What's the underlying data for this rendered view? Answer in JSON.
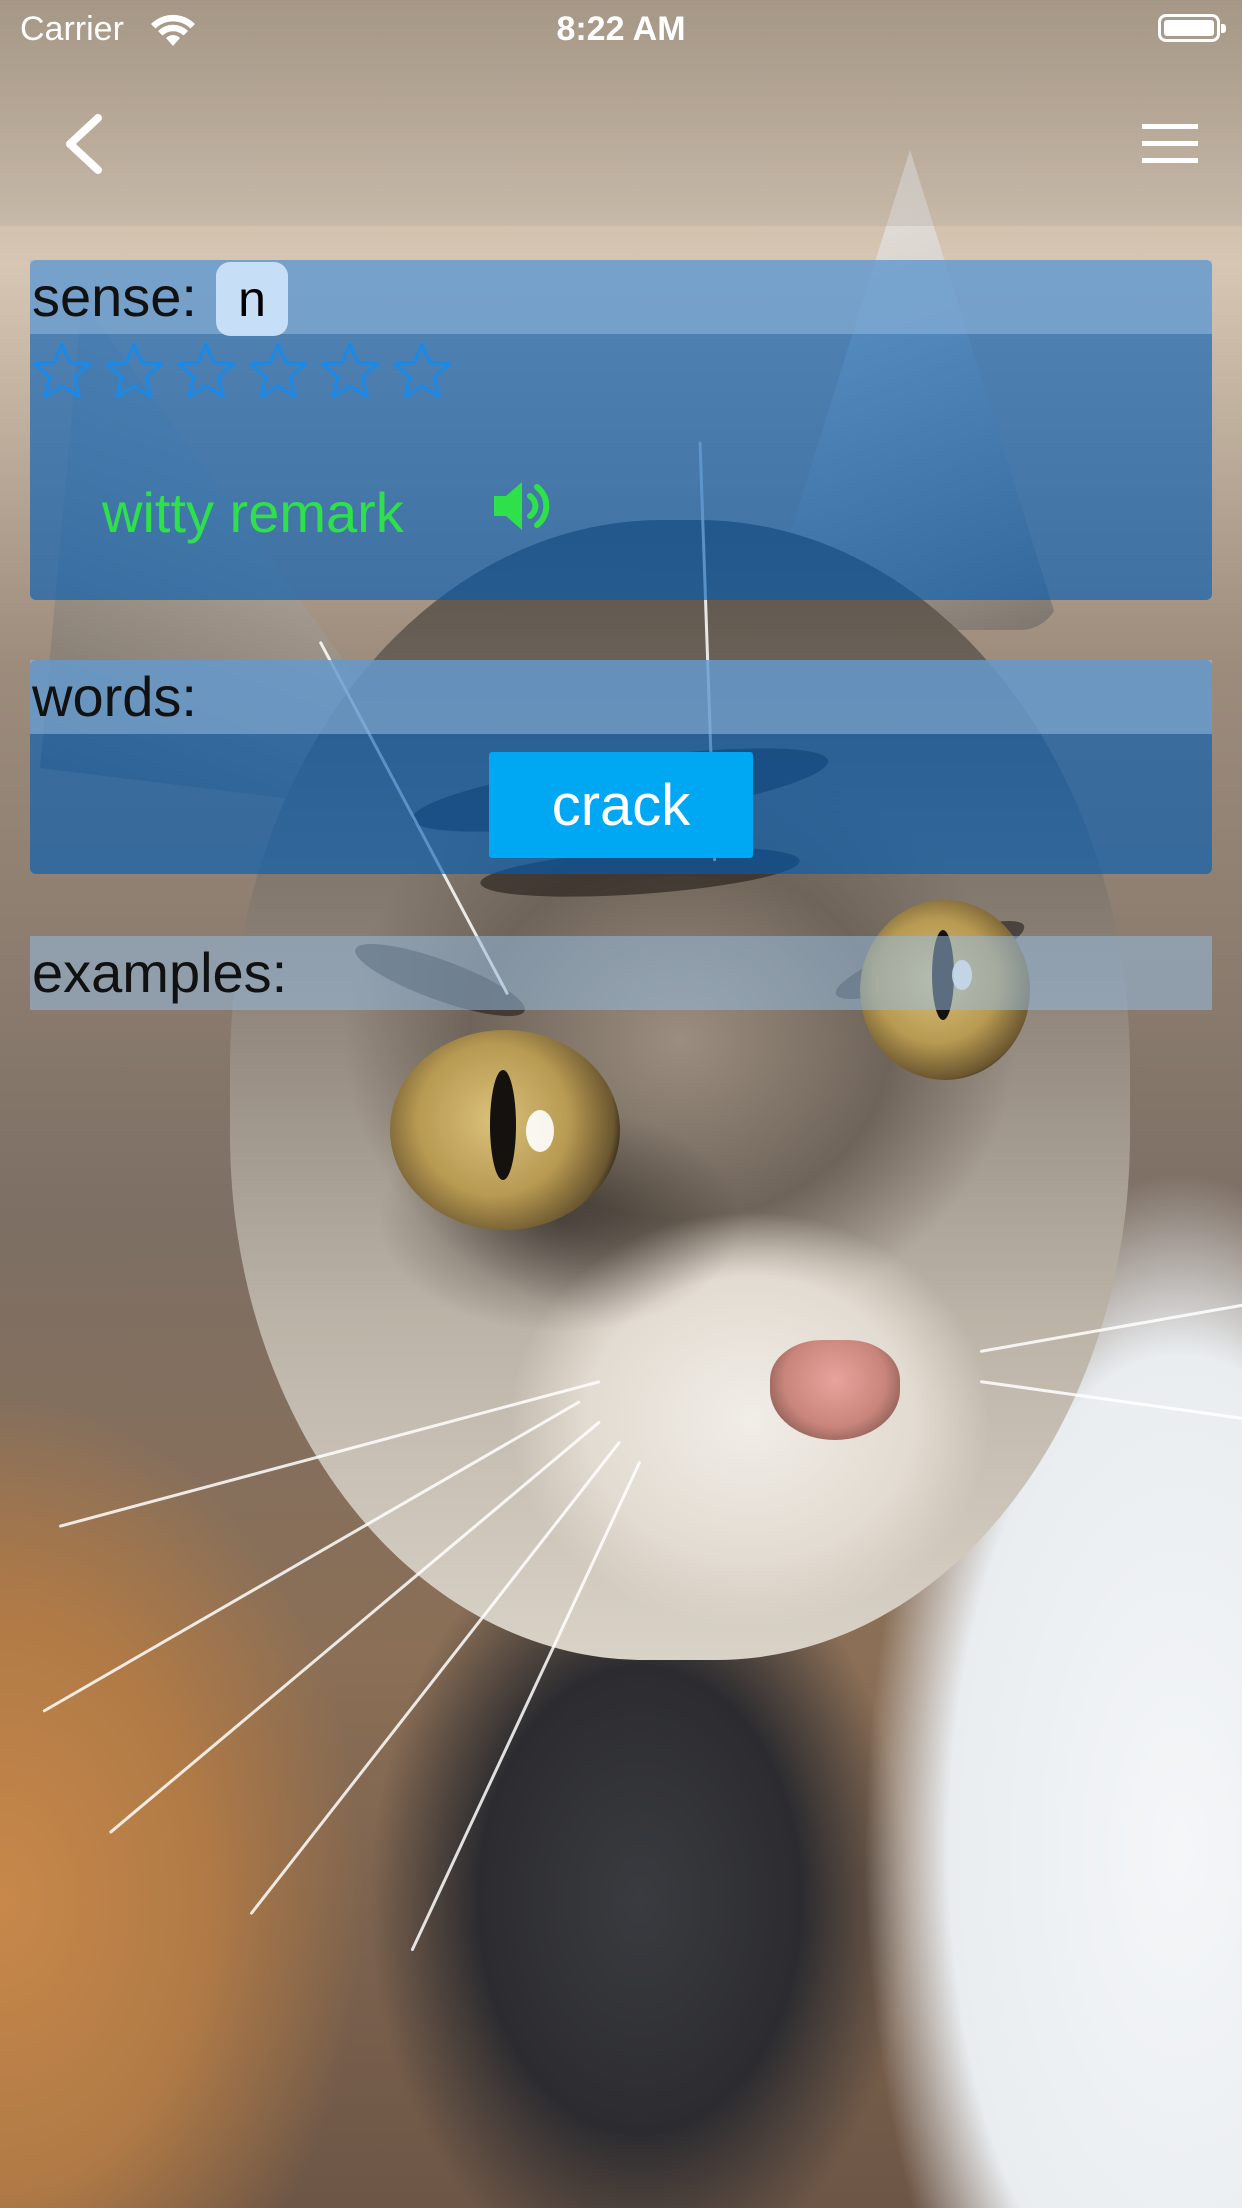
{
  "status_bar": {
    "carrier": "Carrier",
    "time": "8:22 AM"
  },
  "nav": {
    "back_icon": "chevron-left-icon",
    "menu_icon": "hamburger-menu-icon"
  },
  "sense": {
    "label": "sense:",
    "part_of_speech": "n",
    "rating": {
      "max": 6,
      "filled": 0
    },
    "text": "witty remark",
    "audio_icon": "speaker-icon",
    "text_color": "#2ee04a"
  },
  "words": {
    "label": "words:",
    "items": [
      "crack"
    ],
    "button_color": "#00a8f4"
  },
  "examples": {
    "label": "examples:"
  },
  "colors": {
    "panel": "#005cb4",
    "star_outline": "#1e88e5"
  }
}
